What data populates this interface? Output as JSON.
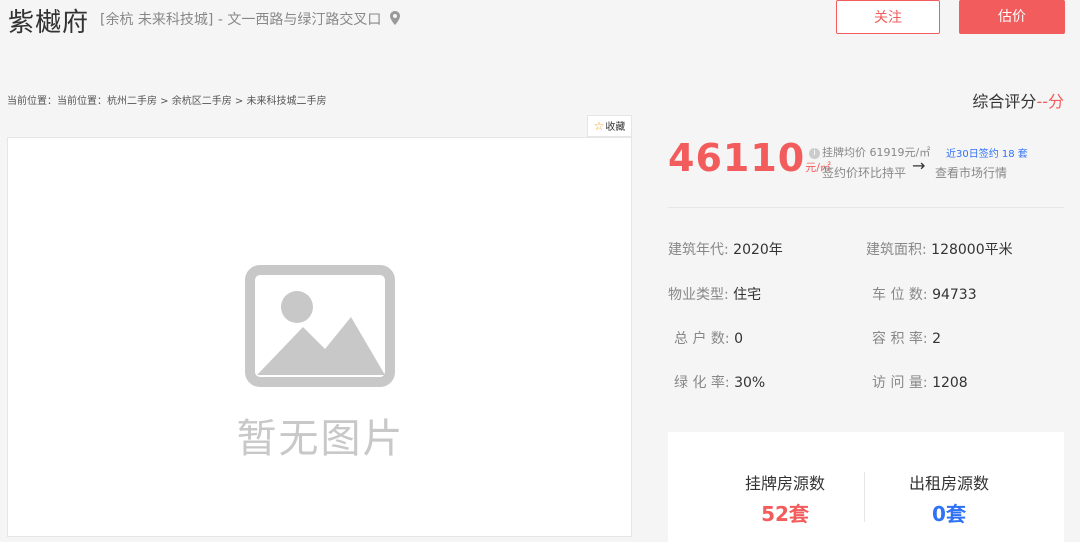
{
  "header": {
    "title": "紫樾府",
    "address": "[余杭 未来科技城] - 文一西路与绿汀路交叉口",
    "follow_label": "关注",
    "estimate_label": "估价"
  },
  "breadcrumb": {
    "prefix": "当前位置：",
    "items": [
      "当前位置：杭州二手房",
      "余杭区二手房",
      "未来科技城二手房"
    ],
    "separator": " > "
  },
  "score": {
    "label": "综合评分",
    "value": "--分"
  },
  "favorite_label": "收藏",
  "photo": {
    "placeholder_text": "暂无图片"
  },
  "price": {
    "value": "46110",
    "unit": "元/㎡",
    "listing_avg": "挂牌均价 61919元/㎡",
    "recent_deals": "近30日签约 18 套",
    "mom": "签约价环比持平",
    "arrow": "→",
    "market_link": "查看市场行情"
  },
  "properties": {
    "year_label": "建筑年代:",
    "year_value": "2020年",
    "area_label": "建筑面积:",
    "area_value": "128000平米",
    "type_label": "物业类型:",
    "type_value": "住宅",
    "parking_label": "车 位 数:",
    "parking_value": "94733",
    "households_label": "总 户 数:",
    "households_value": "0",
    "far_label": "容 积 率:",
    "far_value": "2",
    "green_label": "绿 化 率:",
    "green_value": "30%",
    "visits_label": "访 问 量:",
    "visits_value": "1208"
  },
  "stats": {
    "listing_label": "挂牌房源数",
    "listing_value": "52套",
    "rental_label": "出租房源数",
    "rental_value": "0套"
  },
  "colors": {
    "accent": "#f25c5c",
    "link": "#3072f6",
    "icon_gray": "#c8c8c8"
  }
}
